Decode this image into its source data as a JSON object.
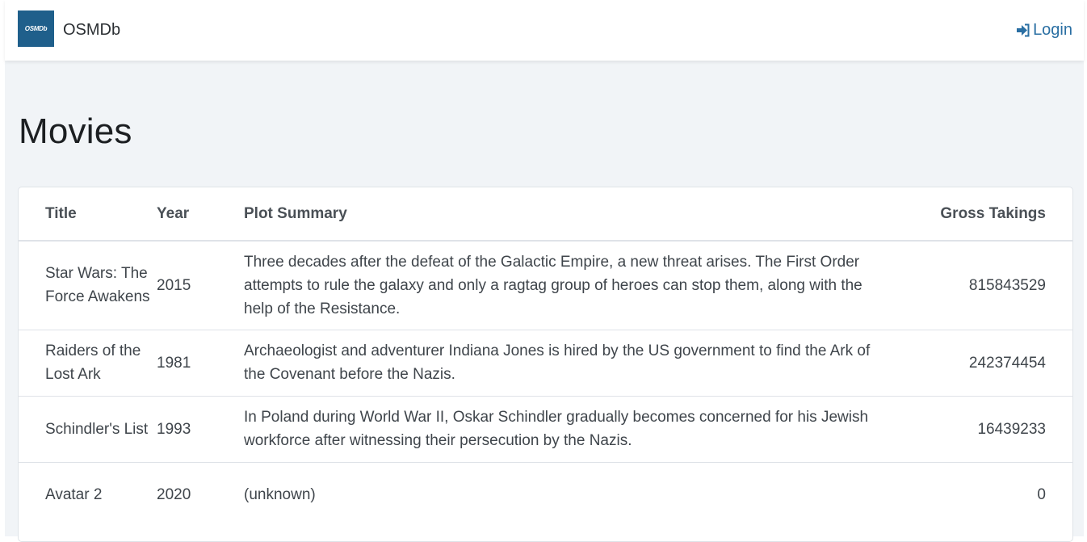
{
  "app": {
    "logo_text": "OSMDb",
    "name": "OSMDb",
    "login_label": "Login",
    "accent_color": "#2a6fa3",
    "logo_color": "#1f5f8b"
  },
  "page": {
    "title": "Movies"
  },
  "table": {
    "headers": {
      "title": "Title",
      "year": "Year",
      "plot": "Plot Summary",
      "gross": "Gross Takings"
    },
    "rows": [
      {
        "title": "Star Wars: The Force Awakens",
        "year": "2015",
        "plot": "Three decades after the defeat of the Galactic Empire, a new threat arises. The First Order attempts to rule the galaxy and only a ragtag group of heroes can stop them, along with the help of the Resistance.",
        "gross": "815843529"
      },
      {
        "title": "Raiders of the Lost Ark",
        "year": "1981",
        "plot": "Archaeologist and adventurer Indiana Jones is hired by the US government to find the Ark of the Covenant before the Nazis.",
        "gross": "242374454"
      },
      {
        "title": "Schindler's List",
        "year": "1993",
        "plot": "In Poland during World War II, Oskar Schindler gradually becomes concerned for his Jewish workforce after witnessing their persecution by the Nazis.",
        "gross": "16439233"
      },
      {
        "title": "Avatar 2",
        "year": "2020",
        "plot": "(unknown)",
        "gross": "0"
      }
    ]
  }
}
